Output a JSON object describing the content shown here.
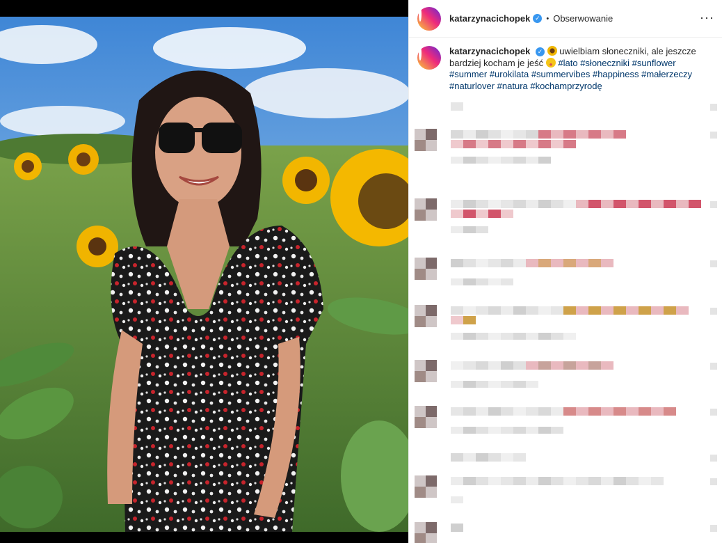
{
  "post": {
    "username": "katarzynacichopek",
    "verified_mark": "✓",
    "separator": "•",
    "follow_status": "Obserwowanie",
    "more_label": "···"
  },
  "caption": {
    "username": "katarzynacichopek",
    "text_part1": "uwielbiam słoneczniki, ale jeszcze bardziej kocham je jeść",
    "hashtags": [
      "#lato",
      "#słoneczniki",
      "#sunflower",
      "#summer",
      "#urokilata",
      "#summervibes",
      "#happiness",
      "#małerzeczy",
      "#naturlover",
      "#natura",
      "#kochamprzyrodę"
    ]
  },
  "icons": {
    "verified": "verified-badge-icon",
    "more": "more-options-icon",
    "sunflower_emoji": "sunflower-emoji-icon",
    "yum_emoji": "yum-face-emoji-icon"
  },
  "colors": {
    "hashtag": "#00376b",
    "verified": "#3897f0",
    "border": "#efefef",
    "text": "#262626"
  }
}
